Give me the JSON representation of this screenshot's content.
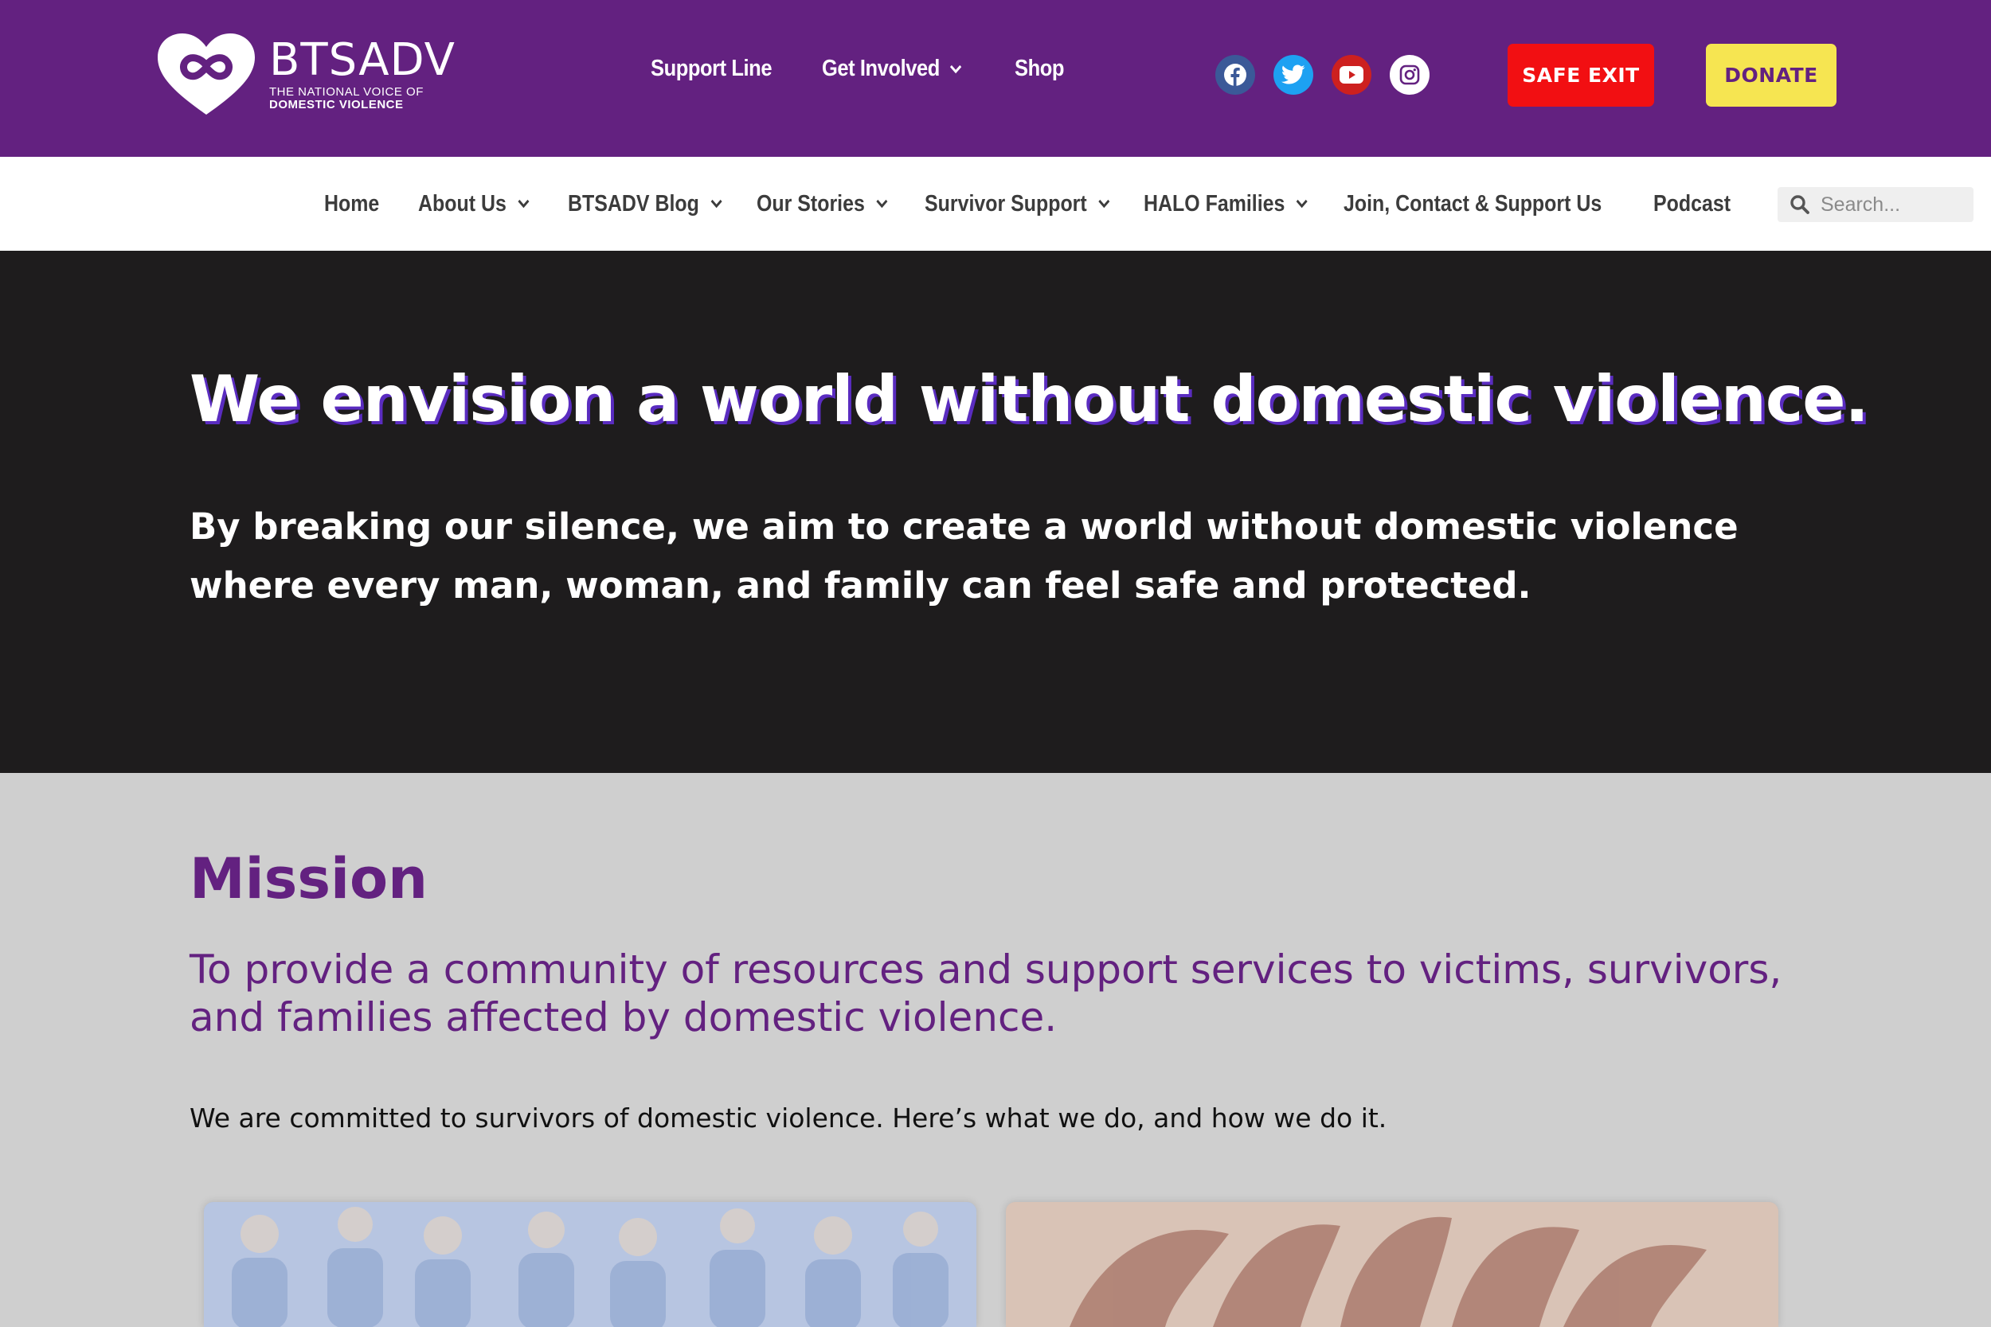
{
  "brand": {
    "name": "BTSADV",
    "tagline_line1": "THE NATIONAL VOICE OF",
    "tagline_line2": "DOMESTIC VIOLENCE"
  },
  "topnav": {
    "items": [
      {
        "label": "Support Line",
        "has_dropdown": false
      },
      {
        "label": "Get Involved",
        "has_dropdown": true
      },
      {
        "label": "Shop",
        "has_dropdown": false
      }
    ]
  },
  "social": [
    {
      "icon": "facebook-icon",
      "color": "#3b5998"
    },
    {
      "icon": "twitter-icon",
      "color": "#1da1f2"
    },
    {
      "icon": "youtube-icon",
      "color": "#cd201f"
    },
    {
      "icon": "instagram-icon",
      "color": "#ffffff"
    }
  ],
  "buttons": {
    "safe_exit": "SAFE EXIT",
    "donate": "DONATE"
  },
  "mainnav": {
    "items": [
      {
        "label": "Home",
        "has_dropdown": false
      },
      {
        "label": "About Us",
        "has_dropdown": true
      },
      {
        "label": "BTSADV Blog",
        "has_dropdown": true
      },
      {
        "label": "Our Stories",
        "has_dropdown": true
      },
      {
        "label": "Survivor Support",
        "has_dropdown": true
      },
      {
        "label": "HALO Families",
        "has_dropdown": true
      },
      {
        "label": "Join, Contact & Support Us",
        "has_dropdown": true
      },
      {
        "label": "Podcast",
        "has_dropdown": false
      }
    ]
  },
  "search": {
    "placeholder": "Search..."
  },
  "hero": {
    "title": "We envision a world without domestic violence.",
    "subtitle": "By breaking our silence, we aim to create a world without domestic violence where every man, woman, and family can feel safe and protected."
  },
  "mission": {
    "title": "Mission",
    "lead": "To provide a community of resources and support services to victims, survivors, and families affected by domestic violence.",
    "body": "We are committed to survivors of domestic violence. Here’s what we do, and how we do it."
  },
  "colors": {
    "brand_purple": "#632180",
    "safe_exit_red": "#f20f12",
    "donate_yellow": "#f6e551",
    "hero_bg": "#1e1c1d",
    "section_bg": "#cfcfcf"
  }
}
